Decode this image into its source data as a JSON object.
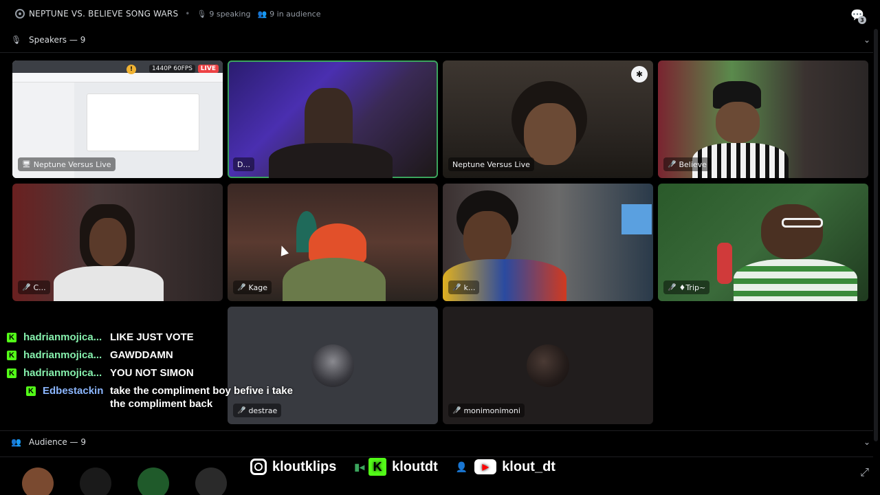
{
  "topbar": {
    "stage_icon": "stage-channel-icon",
    "title": "NEPTUNE VS. BELIEVE SONG WARS",
    "speaking": "9 speaking",
    "audience": "9 in audience",
    "inbox_badge": "3"
  },
  "speakers_section": {
    "label": "Speakers — 9"
  },
  "audience_section": {
    "label": "Audience — 9"
  },
  "tiles": [
    {
      "label": "Neptune Versus Live",
      "muted": false,
      "screen": true,
      "quality": "1440P 60FPS",
      "live": "LIVE",
      "warn": "!"
    },
    {
      "label": "D...",
      "muted": false,
      "speaking": true
    },
    {
      "label": "Neptune Versus Live",
      "muted": false,
      "mod": true
    },
    {
      "label": "Believe",
      "muted": true
    },
    {
      "label": "C...",
      "muted": true
    },
    {
      "label": "Kage",
      "muted": true
    },
    {
      "label": "k...",
      "muted": true
    },
    {
      "label": "♦Trip~",
      "muted": true
    },
    {
      "label": "destrae",
      "muted": true
    },
    {
      "label": "monimonimoni",
      "muted": true
    }
  ],
  "chat": [
    {
      "user": "hadrianmojica...",
      "text": "LIKE JUST VOTE"
    },
    {
      "user": "hadrianmojica...",
      "text": "GAWDDAMN"
    },
    {
      "user": "hadrianmojica...",
      "text": "YOU NOT SIMON"
    },
    {
      "user": "Edbestackin",
      "text": "take the compliment boy befive i take the compliment back"
    }
  ],
  "socials": {
    "instagram": "kloutklips",
    "kick": "kloutdt",
    "youtube": "klout_dt"
  },
  "colors": {
    "speaking_outline": "#3ba55d",
    "kick_green": "#53fc18",
    "live_red": "#ed4245"
  }
}
